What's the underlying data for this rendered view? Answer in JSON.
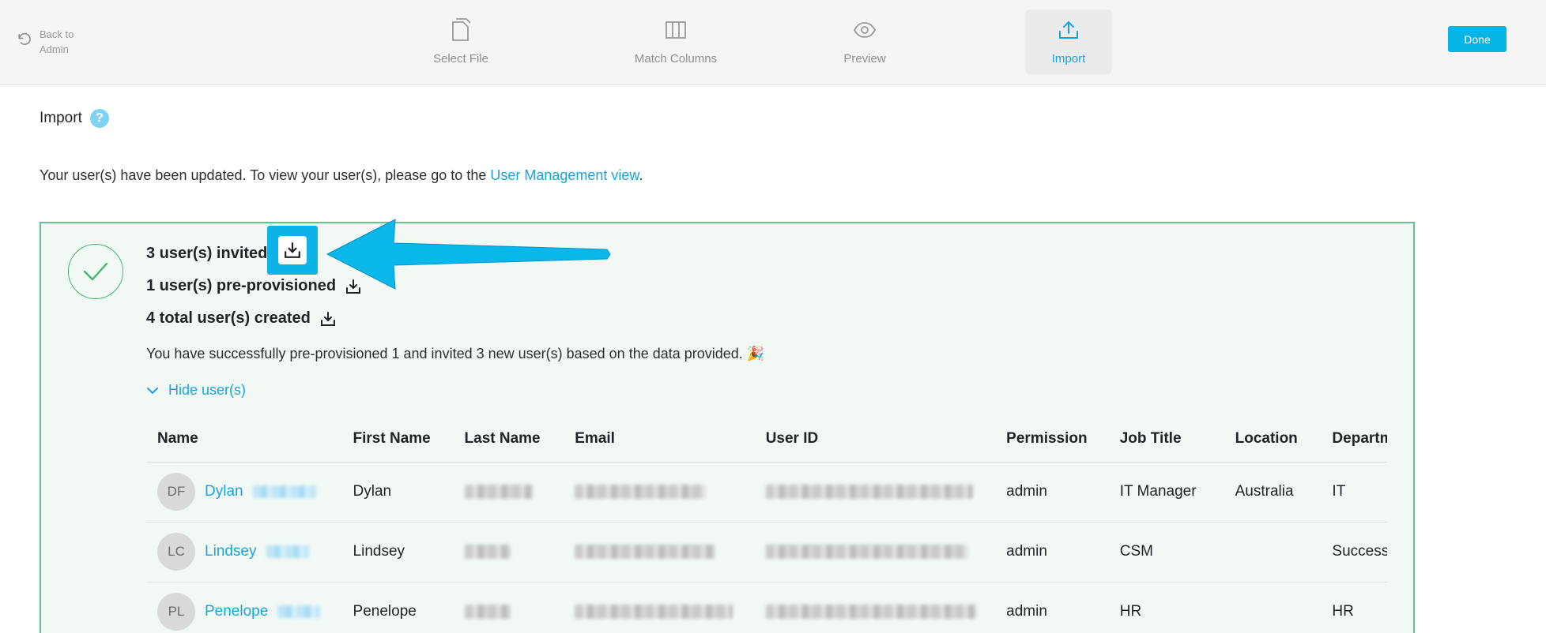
{
  "topbar": {
    "back_label": "Back to Admin",
    "steps": [
      {
        "label": "Select File",
        "icon": "file-icon",
        "active": false
      },
      {
        "label": "Match Columns",
        "icon": "columns-icon",
        "active": false
      },
      {
        "label": "Preview",
        "icon": "eye-icon",
        "active": false
      },
      {
        "label": "Import",
        "icon": "upload-icon",
        "active": true
      }
    ],
    "done_label": "Done"
  },
  "page": {
    "title": "Import",
    "help_label": "?",
    "message_prefix": "Your user(s) have been updated. To view your user(s), please go to the ",
    "message_link": "User Management view",
    "message_suffix": "."
  },
  "results": {
    "invited": "3 user(s) invited",
    "preprovisioned": "1 user(s) pre-provisioned",
    "total": "4 total user(s) created",
    "success_message": "You have successfully pre-provisioned 1 and invited 3 new user(s) based on the data provided. 🎉",
    "toggle_label": "Hide user(s)"
  },
  "table": {
    "headers": [
      "Name",
      "First Name",
      "Last Name",
      "Email",
      "User ID",
      "Permission",
      "Job Title",
      "Location",
      "Department"
    ],
    "rows": [
      {
        "initials": "DF",
        "name": "Dylan",
        "first_name": "Dylan",
        "permission": "admin",
        "job_title": "IT Manager",
        "location": "Australia",
        "department": "IT"
      },
      {
        "initials": "LC",
        "name": "Lindsey",
        "first_name": "Lindsey",
        "permission": "admin",
        "job_title": "CSM",
        "location": "",
        "department": "Success"
      },
      {
        "initials": "PL",
        "name": "Penelope",
        "first_name": "Penelope",
        "permission": "admin",
        "job_title": "HR",
        "location": "",
        "department": "HR"
      }
    ]
  },
  "colors": {
    "accent": "#06b4e6",
    "link": "#1aa3dc",
    "success_border": "#5bc88a",
    "success_bg": "#f2f9f5",
    "arrow": "#0ab7ea"
  }
}
